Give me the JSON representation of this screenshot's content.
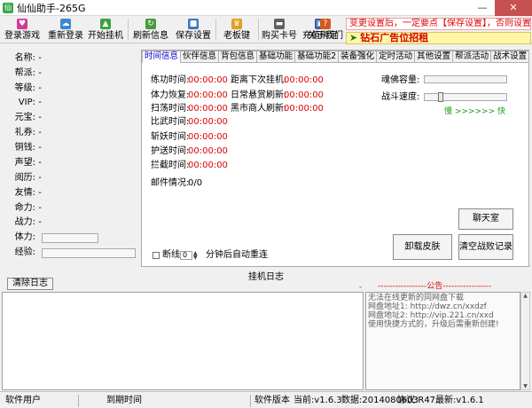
{
  "window": {
    "title": "仙仙助手-265G",
    "app_icon": "仙"
  },
  "toolbar": {
    "buttons": [
      {
        "label": "登录游戏",
        "icon": "heart-icon"
      },
      {
        "label": "重新登录",
        "icon": "cloud-icon"
      },
      {
        "label": "开始挂机",
        "icon": "sprout-icon"
      },
      {
        "label": "刷新信息",
        "icon": "refresh-icon"
      },
      {
        "label": "保存设置",
        "icon": "save-icon"
      },
      {
        "label": "老板键",
        "icon": "crown-icon"
      },
      {
        "label": "购买卡号",
        "icon": "card-icon"
      },
      {
        "label": "充值绑定",
        "icon": "monitor-icon"
      },
      {
        "label": "关于我们",
        "icon": "question-icon"
      }
    ],
    "ad_top": "变更设置后，一定要点【保存设置】，否则设置无效！",
    "ad_banner": "钻石广告位招租"
  },
  "character": [
    {
      "label": "名称:",
      "value": "-"
    },
    {
      "label": "帮派:",
      "value": "-"
    },
    {
      "label": "等级:",
      "value": "-"
    },
    {
      "label": "VIP:",
      "value": "-"
    },
    {
      "label": "元宝:",
      "value": "-"
    },
    {
      "label": "礼券:",
      "value": "-"
    },
    {
      "label": "铜钱:",
      "value": "-"
    },
    {
      "label": "声望:",
      "value": "-"
    },
    {
      "label": "阅历:",
      "value": "-"
    },
    {
      "label": "友情:",
      "value": "-"
    },
    {
      "label": "命力:",
      "value": "-"
    },
    {
      "label": "战力:",
      "value": "-"
    },
    {
      "label": "体力:",
      "value": ""
    },
    {
      "label": "经验:",
      "value": ""
    }
  ],
  "tabs": [
    "时间信息",
    "伙伴信息",
    "背包信息",
    "基础功能",
    "基础功能2",
    "装备强化",
    "定时活动",
    "其他设置",
    "帮派活动",
    "战术设置"
  ],
  "time_info": {
    "col1": [
      {
        "label": "练功时间:",
        "value": "00:00:00"
      },
      {
        "label": "体力恢复:",
        "value": "00:00:00"
      },
      {
        "label": "扫荡时间:",
        "value": "00:00:00"
      },
      {
        "label": "比武时间:",
        "value": "00:00:00"
      },
      {
        "label": "斩妖时间:",
        "value": "00:00:00"
      },
      {
        "label": "护送时间:",
        "value": "00:00:00"
      },
      {
        "label": "拦截时间:",
        "value": "00:00:00"
      }
    ],
    "col2": [
      {
        "label": "距离下次挂机:",
        "value": "00:00:00"
      },
      {
        "label": "日常悬赏刷新:",
        "value": "00:00:00"
      },
      {
        "label": "黑市商人刷新:",
        "value": "00:00:00"
      }
    ],
    "mail_label": "邮件情况:",
    "mail_value": "0/0",
    "soul_label": "魂佛容量:",
    "speed_label": "战斗速度:",
    "speed_slow": "慢",
    "speed_arrows": ">>>>>>",
    "speed_fast": "快"
  },
  "buttons": {
    "chat": "聊天室",
    "unload": "卸载皮肤",
    "clear": "清空战败记录"
  },
  "reconnect": {
    "label1": "断线",
    "value": "0",
    "label2": "分钟后自动重连"
  },
  "log": {
    "title": "挂机日志",
    "clear_label": "清除日志",
    "dash_left": "-",
    "notice_title": "-----------------公告-----------------"
  },
  "notice": [
    "无法在线更新的同网盘下载",
    "网盘地址1: http://dwz.cn/xxdzf",
    "网盘地址2: http://vip.221.cn/xxd",
    "",
    "使用快捷方式的，升级后需重新创建!"
  ],
  "status": {
    "user_label": "软件用户",
    "expire_label": "到期时间",
    "version_label": "软件版本",
    "current": "当前:v1.6.3",
    "data": "数据:2014080603",
    "protocol": "协议:R47",
    "latest": "最新:v1.6.1"
  },
  "colors": {
    "accent": "#0000d0",
    "timer": "#e00000",
    "ad": "#e00000"
  }
}
